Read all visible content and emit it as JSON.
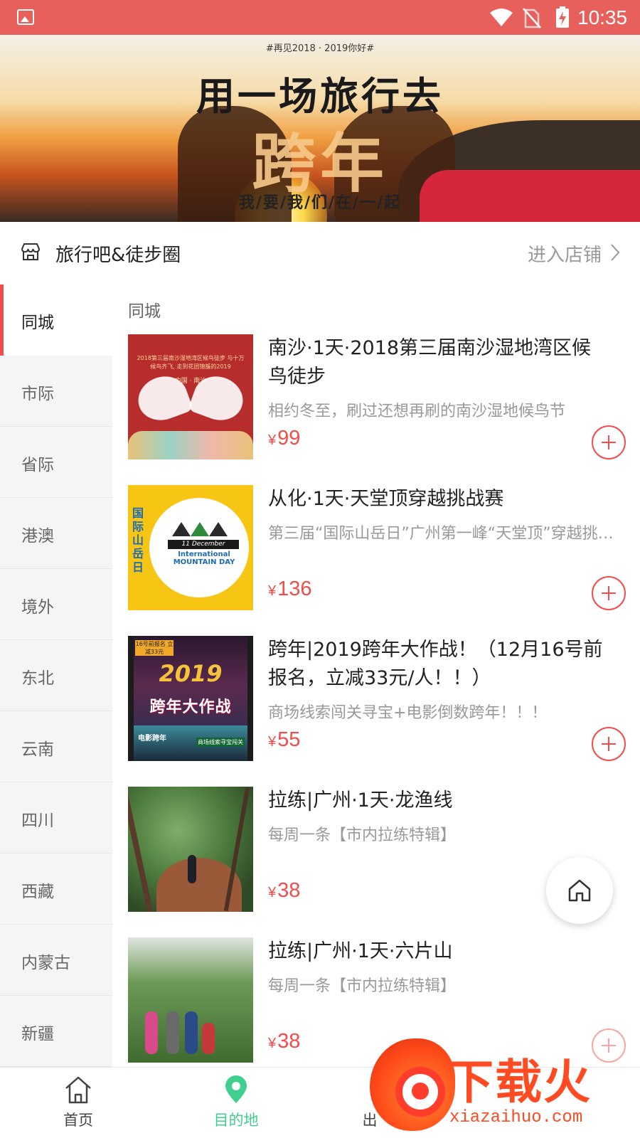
{
  "status_bar": {
    "time": "10:35"
  },
  "banner": {
    "tag": "#再见2018 · 2019你好#",
    "title": "用一场旅行去",
    "big_text": "跨年",
    "subtitle": "我/要/我/们/在/一/起"
  },
  "shop": {
    "name": "旅行吧&徒步圈",
    "enter_label": "进入店铺"
  },
  "sidebar": {
    "items": [
      {
        "label": "同城",
        "active": true
      },
      {
        "label": "市际"
      },
      {
        "label": "省际"
      },
      {
        "label": "港澳"
      },
      {
        "label": "境外"
      },
      {
        "label": "东北"
      },
      {
        "label": "云南"
      },
      {
        "label": "四川"
      },
      {
        "label": "西藏"
      },
      {
        "label": "内蒙古"
      },
      {
        "label": "新疆"
      }
    ]
  },
  "content": {
    "section_title": "同城",
    "currency": "¥",
    "products": [
      {
        "title": "南沙·1天·2018第三届南沙湿地湾区候鸟徒步",
        "desc": "相约冬至，刷过还想再刷的南沙湿地候鸟节",
        "price": "99",
        "thumb_text": "2018第三届南沙湿地湾区候鸟徒步 与十万候鸟齐飞, 走到花团锦簇的2019",
        "thumb_sub": "中国 · 南沙"
      },
      {
        "title": "从化·1天·天堂顶穿越挑战赛",
        "desc": "第三届“国际山岳日”广州第一峰“天堂顶”穿越挑战赛",
        "price": "136",
        "thumb_vtext": "国际山岳日",
        "thumb_date": "11 December",
        "thumb_day": "International MOUNTAIN DAY"
      },
      {
        "title": "跨年|2019跨年大作战！（12月16号前报名，立减33元/人！！）",
        "desc": "商场线索闯关寻宝+电影倒数跨年！！！",
        "price": "55",
        "thumb_tag": "16号前报名 立减33元",
        "thumb_year": "2019",
        "thumb_big": "跨年大作战",
        "thumb_l1": "电影跨年",
        "thumb_l2": "商场线索寻宝闯关"
      },
      {
        "title": "拉练|广州·1天·龙渔线",
        "desc": "每周一条【市内拉练特辑】",
        "price": "38"
      },
      {
        "title": "拉练|广州·1天·六片山",
        "desc": "每周一条【市内拉练特辑】",
        "price": "38"
      }
    ]
  },
  "bottom_nav": {
    "items": [
      {
        "label": "首页",
        "icon": "home-icon"
      },
      {
        "label": "目的地",
        "icon": "location-pin-icon",
        "active": true
      },
      {
        "label": "出"
      }
    ]
  },
  "watermark": {
    "brand": "下载火",
    "site": "xiazaihuo.com"
  },
  "colors": {
    "status_bar": "#e8605c",
    "accent": "#f24c4c",
    "nav_active": "#3fcf8e"
  }
}
